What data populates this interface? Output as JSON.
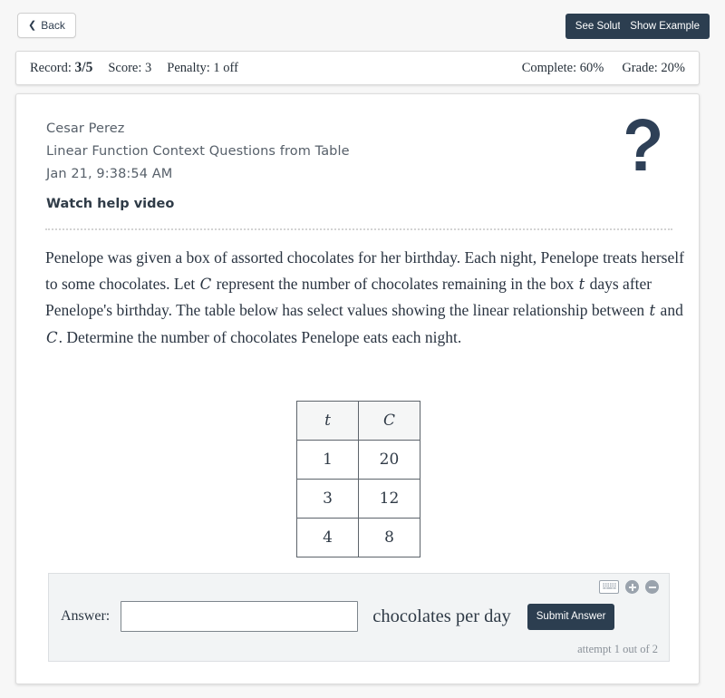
{
  "toolbar": {
    "back_label": "Back",
    "back_chevron": "chevron-left-icon",
    "see_solution_label": "See Solution",
    "show_example_label": "Show Example"
  },
  "status_bar": {
    "record_label": "Record:",
    "record_value": "3/5",
    "score_label": "Score:",
    "score_value": "3",
    "penalty_label": "Penalty:",
    "penalty_value": "1 off",
    "complete_label": "Complete:",
    "complete_value": "60%",
    "grade_label": "Grade:",
    "grade_value": "20%"
  },
  "meta": {
    "student_name": "Cesar Perez",
    "assignment_title": "Linear Function Context Questions from Table",
    "timestamp": "Jan 21, 9:38:54 AM",
    "help_video_label": "Watch help video",
    "help_icon": "question-mark-icon"
  },
  "problem": {
    "part1": "Penelope was given a box of assorted chocolates for her birthday. Each night, Penelope treats herself to some chocolates. Let ",
    "var_C1": "C",
    "part2": " represent the number of chocolates remaining in the box ",
    "var_t1": "t",
    "part3": " days after Penelope's birthday. The table below has select values showing the linear relationship between ",
    "var_t2": "t",
    "part4": " and ",
    "var_C2": "C",
    "part5": ". Determine the number of chocolates Penelope eats each night."
  },
  "table": {
    "headers": [
      "t",
      "C"
    ],
    "rows": [
      [
        "1",
        "20"
      ],
      [
        "3",
        "12"
      ],
      [
        "4",
        "8"
      ]
    ]
  },
  "answer": {
    "label": "Answer:",
    "value": "",
    "placeholder": "",
    "unit": "chocolates per day",
    "submit_label": "Submit Answer",
    "attempt_text": "attempt 1 out of 2",
    "keyboard_icon": "keyboard-icon",
    "zoom_in_icon": "zoom-in-icon",
    "zoom_out_icon": "zoom-out-icon"
  },
  "colors": {
    "accent_dark": "#2c3e50",
    "page_background": "#f7f7f7",
    "panel_background": "#f2f4f5",
    "muted_text": "#57606a"
  }
}
